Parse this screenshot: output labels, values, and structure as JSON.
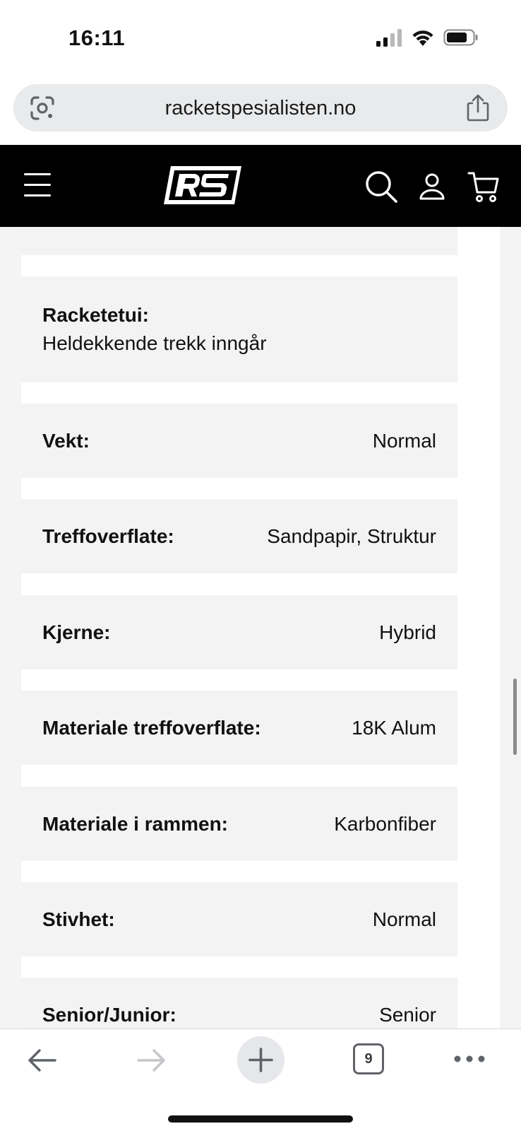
{
  "status_bar": {
    "time": "16:11",
    "icons": [
      "cellular-signal-icon",
      "wifi-icon",
      "battery-icon"
    ]
  },
  "browser": {
    "url": "racketspesialisten.no",
    "icons": [
      "google-lens-icon",
      "share-icon"
    ]
  },
  "site_header": {
    "logo_text": "RS",
    "icons": [
      "menu-icon",
      "search-icon",
      "account-icon",
      "cart-icon"
    ]
  },
  "specs": [
    {
      "label": "",
      "value": ""
    },
    {
      "label": "Racketetui:",
      "value": "Heldekkende trekk inngår"
    },
    {
      "label": "Vekt:",
      "value": "Normal"
    },
    {
      "label": "Treffoverflate:",
      "value": "Sandpapir, Struktur"
    },
    {
      "label": "Kjerne:",
      "value": "Hybrid"
    },
    {
      "label": "Materiale treffoverflate:",
      "value": "18K Alum"
    },
    {
      "label": "Materiale i rammen:",
      "value": "Karbonfiber"
    },
    {
      "label": "Stivhet:",
      "value": "Normal"
    },
    {
      "label": "Senior/Junior:",
      "value": "Senior"
    }
  ],
  "toolbar": {
    "tab_count": "9",
    "icons": [
      "back-arrow-icon",
      "forward-arrow-icon",
      "plus-icon",
      "tabs-icon",
      "more-icon"
    ]
  },
  "colors": {
    "header_bg": "#000000",
    "row_bg": "#f3f3f3",
    "url_bar_bg": "#e9eaec"
  }
}
